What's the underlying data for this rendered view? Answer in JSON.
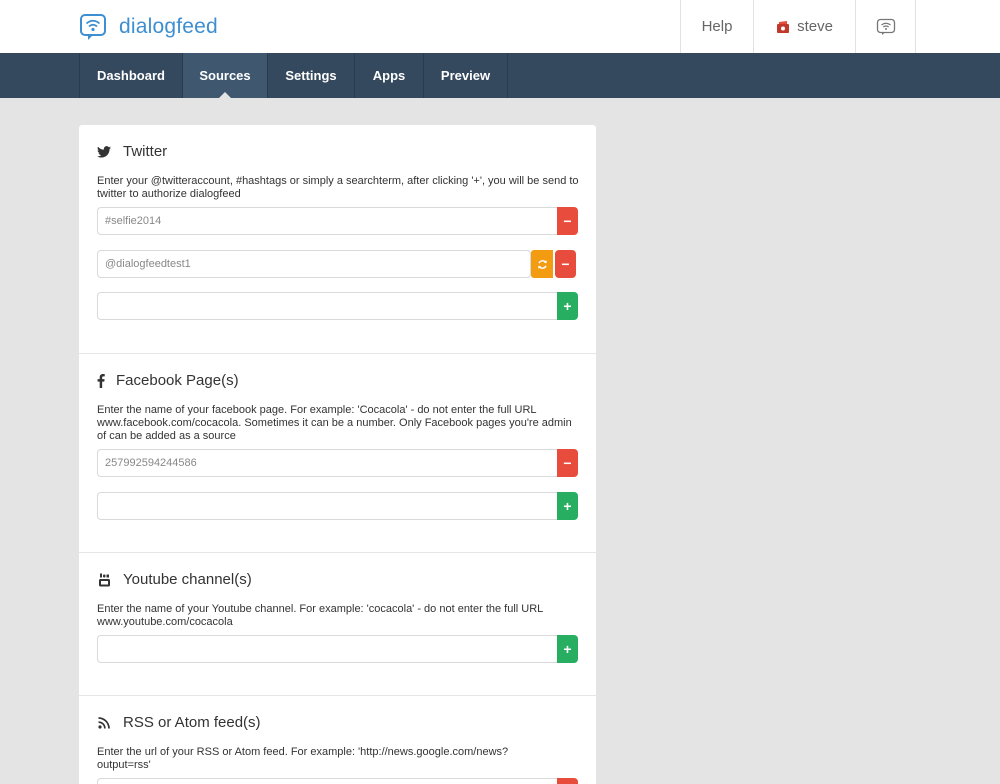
{
  "header": {
    "brand": "dialogfeed",
    "help_label": "Help",
    "user_name": "steve"
  },
  "nav": {
    "tabs": [
      {
        "label": "Dashboard"
      },
      {
        "label": "Sources"
      },
      {
        "label": "Settings"
      },
      {
        "label": "Apps"
      },
      {
        "label": "Preview"
      }
    ],
    "active_tab": "Sources"
  },
  "sections": {
    "twitter": {
      "title": "Twitter",
      "description": "Enter your @twitteraccount, #hashtags or simply a searchterm, after clicking '+', you will be send to twitter to authorize dialogfeed",
      "entries": [
        "#selfie2014",
        "@dialogfeedtest1"
      ],
      "new_value": ""
    },
    "facebook": {
      "title": "Facebook Page(s)",
      "description": "Enter the name of your facebook page. For example: 'Cocacola' - do not enter the full URL www.facebook.com/cocacola. Sometimes it can be a number. Only Facebook pages you're admin of can be added as a source",
      "entries": [
        "257992594244586"
      ],
      "new_value": ""
    },
    "youtube": {
      "title": "Youtube channel(s)",
      "description": "Enter the name of your Youtube channel. For example: 'cocacola' - do not enter the full URL www.youtube.com/cocacola",
      "new_value": ""
    },
    "rss": {
      "title": "RSS or Atom feed(s)",
      "description": "Enter the url of your RSS or Atom feed. For example: 'http://news.google.com/news?output=rss'"
    }
  },
  "icons": {
    "minus": "−",
    "plus": "+"
  },
  "colors": {
    "brand": "#3d8fd1",
    "nav_bg": "#34495e",
    "remove": "#e74c3c",
    "add": "#27ae60",
    "refresh": "#f39c12"
  }
}
